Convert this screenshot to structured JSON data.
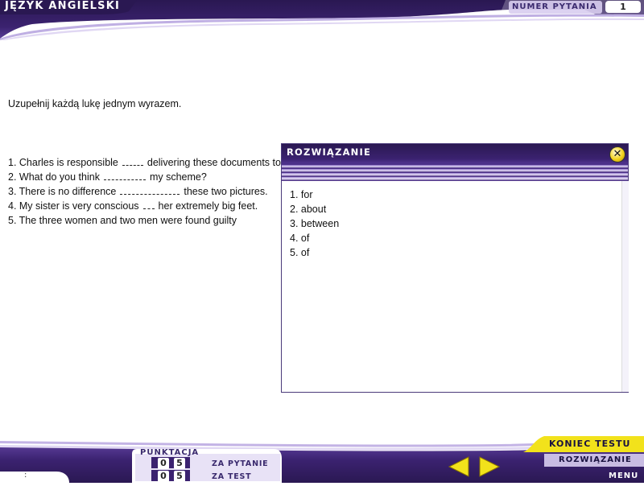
{
  "header": {
    "title": "Język angielski",
    "question_label": "Numer pytania",
    "question_number": "1"
  },
  "content": {
    "instruction": "Uzupełnij każdą lukę jednym wyrazem.",
    "lines": [
      {
        "before": "1. Charles is responsible",
        "after": "delivering these documents to the office."
      },
      {
        "before": "2. What do you think",
        "after": "my scheme?"
      },
      {
        "before": "3. There is no difference",
        "after": "these two pictures."
      },
      {
        "before": "4. My sister is very conscious",
        "after": "her extremely big feet."
      },
      {
        "before": "5. The three women and two men were found guilty",
        "after": ""
      }
    ]
  },
  "solution": {
    "title": "Rozwiązanie",
    "close_icon": "close-icon",
    "answers": [
      "1. for",
      "2. about",
      "3. between",
      "4. of",
      "5. of"
    ]
  },
  "footer": {
    "score_label": "Punktacja",
    "per_question": {
      "left": "0",
      "right": "5",
      "label": "za pytanie"
    },
    "per_test": {
      "left": "0",
      "right": "5",
      "label": "za test"
    },
    "end_test_label": "Koniec testu",
    "solution_label": "Rozwiązanie",
    "menu_label": "Menu",
    "status": ":"
  },
  "colors": {
    "primary_purple": "#3b2270",
    "accent_yellow": "#f2e21b",
    "light_purple": "#b8a6e0"
  }
}
